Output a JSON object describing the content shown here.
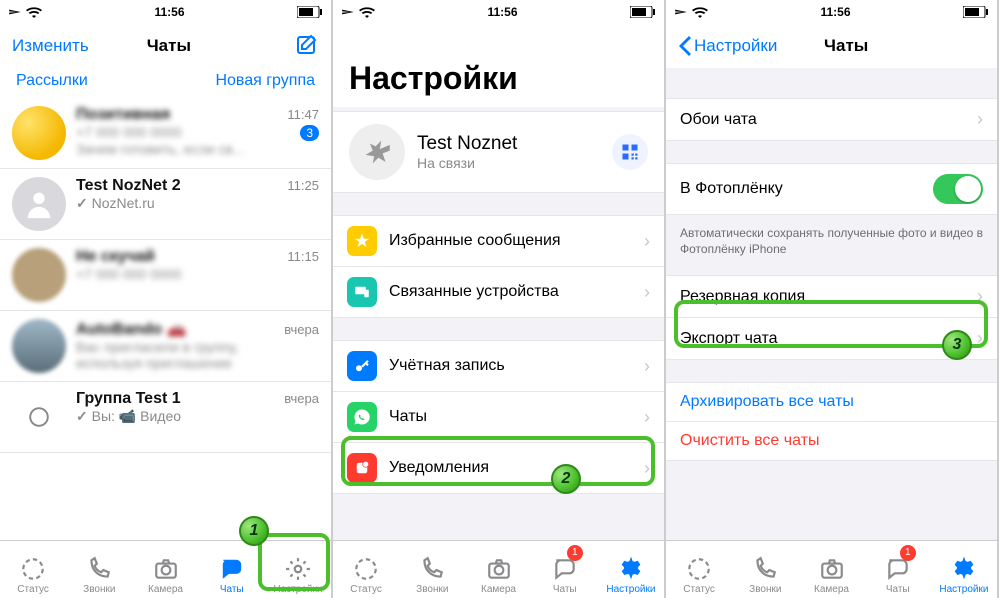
{
  "status": {
    "time": "11:56"
  },
  "phone1": {
    "nav": {
      "edit": "Изменить",
      "title": "Чаты",
      "compose": "compose"
    },
    "sub": {
      "broadcasts": "Рассылки",
      "newgroup": "Новая группа"
    },
    "chats": [
      {
        "name": "Позитивная",
        "time": "11:47",
        "sub1": "",
        "sub2": "Зачем готовить, если св...",
        "badge": "3",
        "blur": true
      },
      {
        "name": "Test NozNet 2",
        "time": "11:25",
        "sub1": "✓ NozNet.ru",
        "blur": false
      },
      {
        "name": "Не скучай",
        "time": "11:15",
        "sub1": "",
        "blur": true
      },
      {
        "name": "AutoBando",
        "time": "вчера",
        "sub1": "Вас пригласили в группу,",
        "sub2": "используя приглашение",
        "blur": true
      },
      {
        "name": "Группа Test 1",
        "time": "вчера",
        "sub1": "✓ Вы: 📹 Видео",
        "blur": false
      }
    ],
    "step": "1"
  },
  "phone2": {
    "title": "Настройки",
    "profile": {
      "name": "Test Noznet",
      "status": "На связи"
    },
    "rows": {
      "starred": "Избранные сообщения",
      "linked": "Связанные устройства",
      "account": "Учётная запись",
      "chats": "Чаты",
      "notifications": "Уведомления"
    },
    "step": "2"
  },
  "phone3": {
    "back": "Настройки",
    "title": "Чаты",
    "rows": {
      "wallpaper": "Обои чата",
      "cameraroll": "В Фотоплёнку",
      "cameraroll_foot": "Автоматически сохранять полученные фото и видео в Фотоплёнку iPhone",
      "backup": "Резервная копия",
      "export": "Экспорт чата",
      "archive": "Архивировать все чаты",
      "clear": "Очистить все чаты"
    },
    "step": "3"
  },
  "tabs": {
    "status": "Статус",
    "calls": "Звонки",
    "camera": "Камера",
    "chats": "Чаты",
    "settings": "Настройки",
    "badge": "1"
  }
}
